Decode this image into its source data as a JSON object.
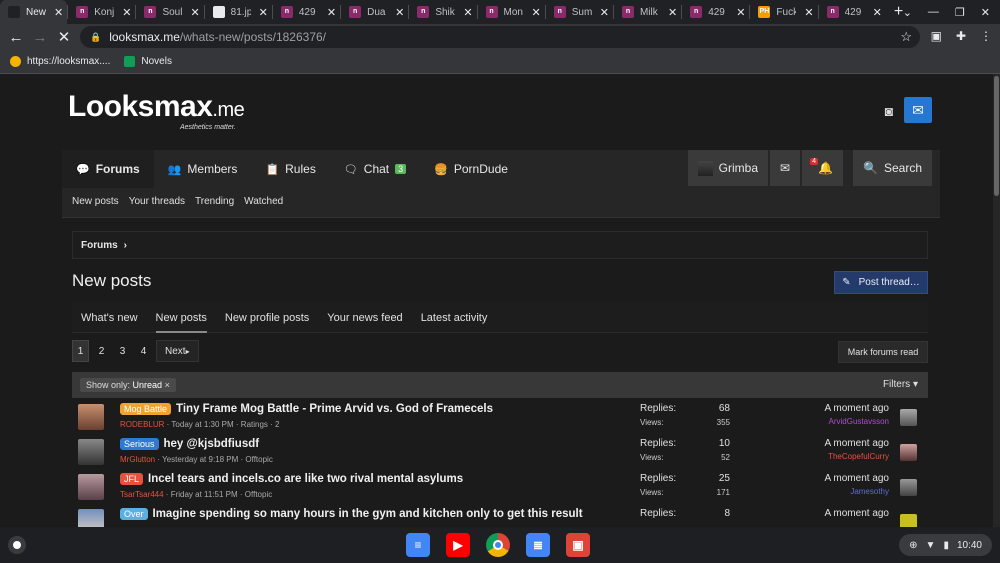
{
  "browser": {
    "tabs": [
      {
        "title": "New",
        "fav_color": "#202124",
        "fav_glyph": "",
        "active": true
      },
      {
        "title": "Konj",
        "fav_color": "#8b2a6a",
        "fav_glyph": "n",
        "active": false
      },
      {
        "title": "Soul",
        "fav_color": "#8b2a6a",
        "fav_glyph": "n",
        "active": false
      },
      {
        "title": "81.jp",
        "fav_color": "#e8eaed",
        "fav_glyph": "",
        "active": false
      },
      {
        "title": "429",
        "fav_color": "#8b2a6a",
        "fav_glyph": "n",
        "active": false
      },
      {
        "title": "Dua",
        "fav_color": "#8b2a6a",
        "fav_glyph": "n",
        "active": false
      },
      {
        "title": "Shik",
        "fav_color": "#8b2a6a",
        "fav_glyph": "n",
        "active": false
      },
      {
        "title": "Mon",
        "fav_color": "#8b2a6a",
        "fav_glyph": "n",
        "active": false
      },
      {
        "title": "Sum",
        "fav_color": "#8b2a6a",
        "fav_glyph": "n",
        "active": false
      },
      {
        "title": "Milk",
        "fav_color": "#8b2a6a",
        "fav_glyph": "n",
        "active": false
      },
      {
        "title": "429",
        "fav_color": "#8b2a6a",
        "fav_glyph": "n",
        "active": false
      },
      {
        "title": "Fuck",
        "fav_color": "#f90",
        "fav_glyph": "PH",
        "active": false
      },
      {
        "title": "429",
        "fav_color": "#8b2a6a",
        "fav_glyph": "n",
        "active": false
      }
    ],
    "new_tab_label": "+",
    "url_host": "looksmax.me",
    "url_path": "/whats-new/posts/1826376/",
    "bookmarks": [
      {
        "label": "https://looksmax....",
        "color": "#f4b400"
      },
      {
        "label": "Novels",
        "color": "#0f9d58"
      }
    ]
  },
  "site": {
    "logo": "Lᴏᴏksmax",
    "logo_tld": ".me",
    "tagline": "Aesthetics matter.",
    "nav": [
      {
        "label": "Forums",
        "icon": "💬",
        "selected": true
      },
      {
        "label": "Members",
        "icon": "👥",
        "selected": false
      },
      {
        "label": "Rules",
        "icon": "📋",
        "selected": false
      },
      {
        "label": "Chat",
        "icon": "🗨",
        "selected": false,
        "badge": "3"
      },
      {
        "label": "PornDude",
        "icon": "🍔",
        "selected": false
      }
    ],
    "user_name": "Grimba",
    "notif_count": "4",
    "search_label": "Search",
    "subnav": [
      "New posts",
      "Your threads",
      "Trending",
      "Watched"
    ],
    "breadcrumb": "Forums",
    "page_title": "New posts",
    "post_thread": "Post thread…",
    "tabs": [
      {
        "label": "What's new",
        "selected": false
      },
      {
        "label": "New posts",
        "selected": true
      },
      {
        "label": "New profile posts",
        "selected": false
      },
      {
        "label": "Your news feed",
        "selected": false
      },
      {
        "label": "Latest activity",
        "selected": false
      }
    ],
    "pages": [
      "1",
      "2",
      "3",
      "4"
    ],
    "next_label": "Next",
    "mark_read": "Mark forums read",
    "filter_prefix": "Show only:",
    "filter_value": "Unread",
    "filters_label": "Filters",
    "replies_label": "Replies:",
    "views_label": "Views:"
  },
  "threads": [
    {
      "prefix": "Mog Battle",
      "prefix_color": "#f0a430",
      "title": "Tiny Frame Mog Battle - Prime Arvid vs. God of Framecels",
      "author": "RODEBLUR",
      "date": "Today at 1:30 PM",
      "meta_extra": "Ratings · 2",
      "replies": "68",
      "views": "355",
      "latest_when": "A moment ago",
      "latest_user": "ArvidGustavsson",
      "latest_color": "#b04ad0"
    },
    {
      "prefix": "Serious",
      "prefix_color": "#2b7bd6",
      "title": "hey @kjsbdfiusdf",
      "author": "MrGlutton",
      "date": "Yesterday at 9:18 PM",
      "meta_extra": "Offtopic",
      "replies": "10",
      "views": "52",
      "latest_when": "A moment ago",
      "latest_user": "TheCopefulCurry",
      "latest_color": "#e5533d"
    },
    {
      "prefix": "JFL",
      "prefix_color": "#e5533d",
      "title": "Incel tears and incels.co are like two rival mental asylums",
      "author": "TsarTsar444",
      "date": "Friday at 11:51 PM",
      "meta_extra": "Offtopic",
      "replies": "25",
      "views": "171",
      "latest_when": "A moment ago",
      "latest_user": "Jamesothy",
      "latest_color": "#5b6ed6"
    },
    {
      "prefix": "Over",
      "prefix_color": "#5ab0e0",
      "title": "Imagine spending so many hours in the gym and kitchen only to get this result",
      "author": "",
      "date": "",
      "meta_extra": "",
      "replies": "8",
      "views": "",
      "latest_when": "A moment ago",
      "latest_user": "",
      "latest_color": "#e0e0e0"
    }
  ],
  "shelf": {
    "time": "10:40"
  }
}
